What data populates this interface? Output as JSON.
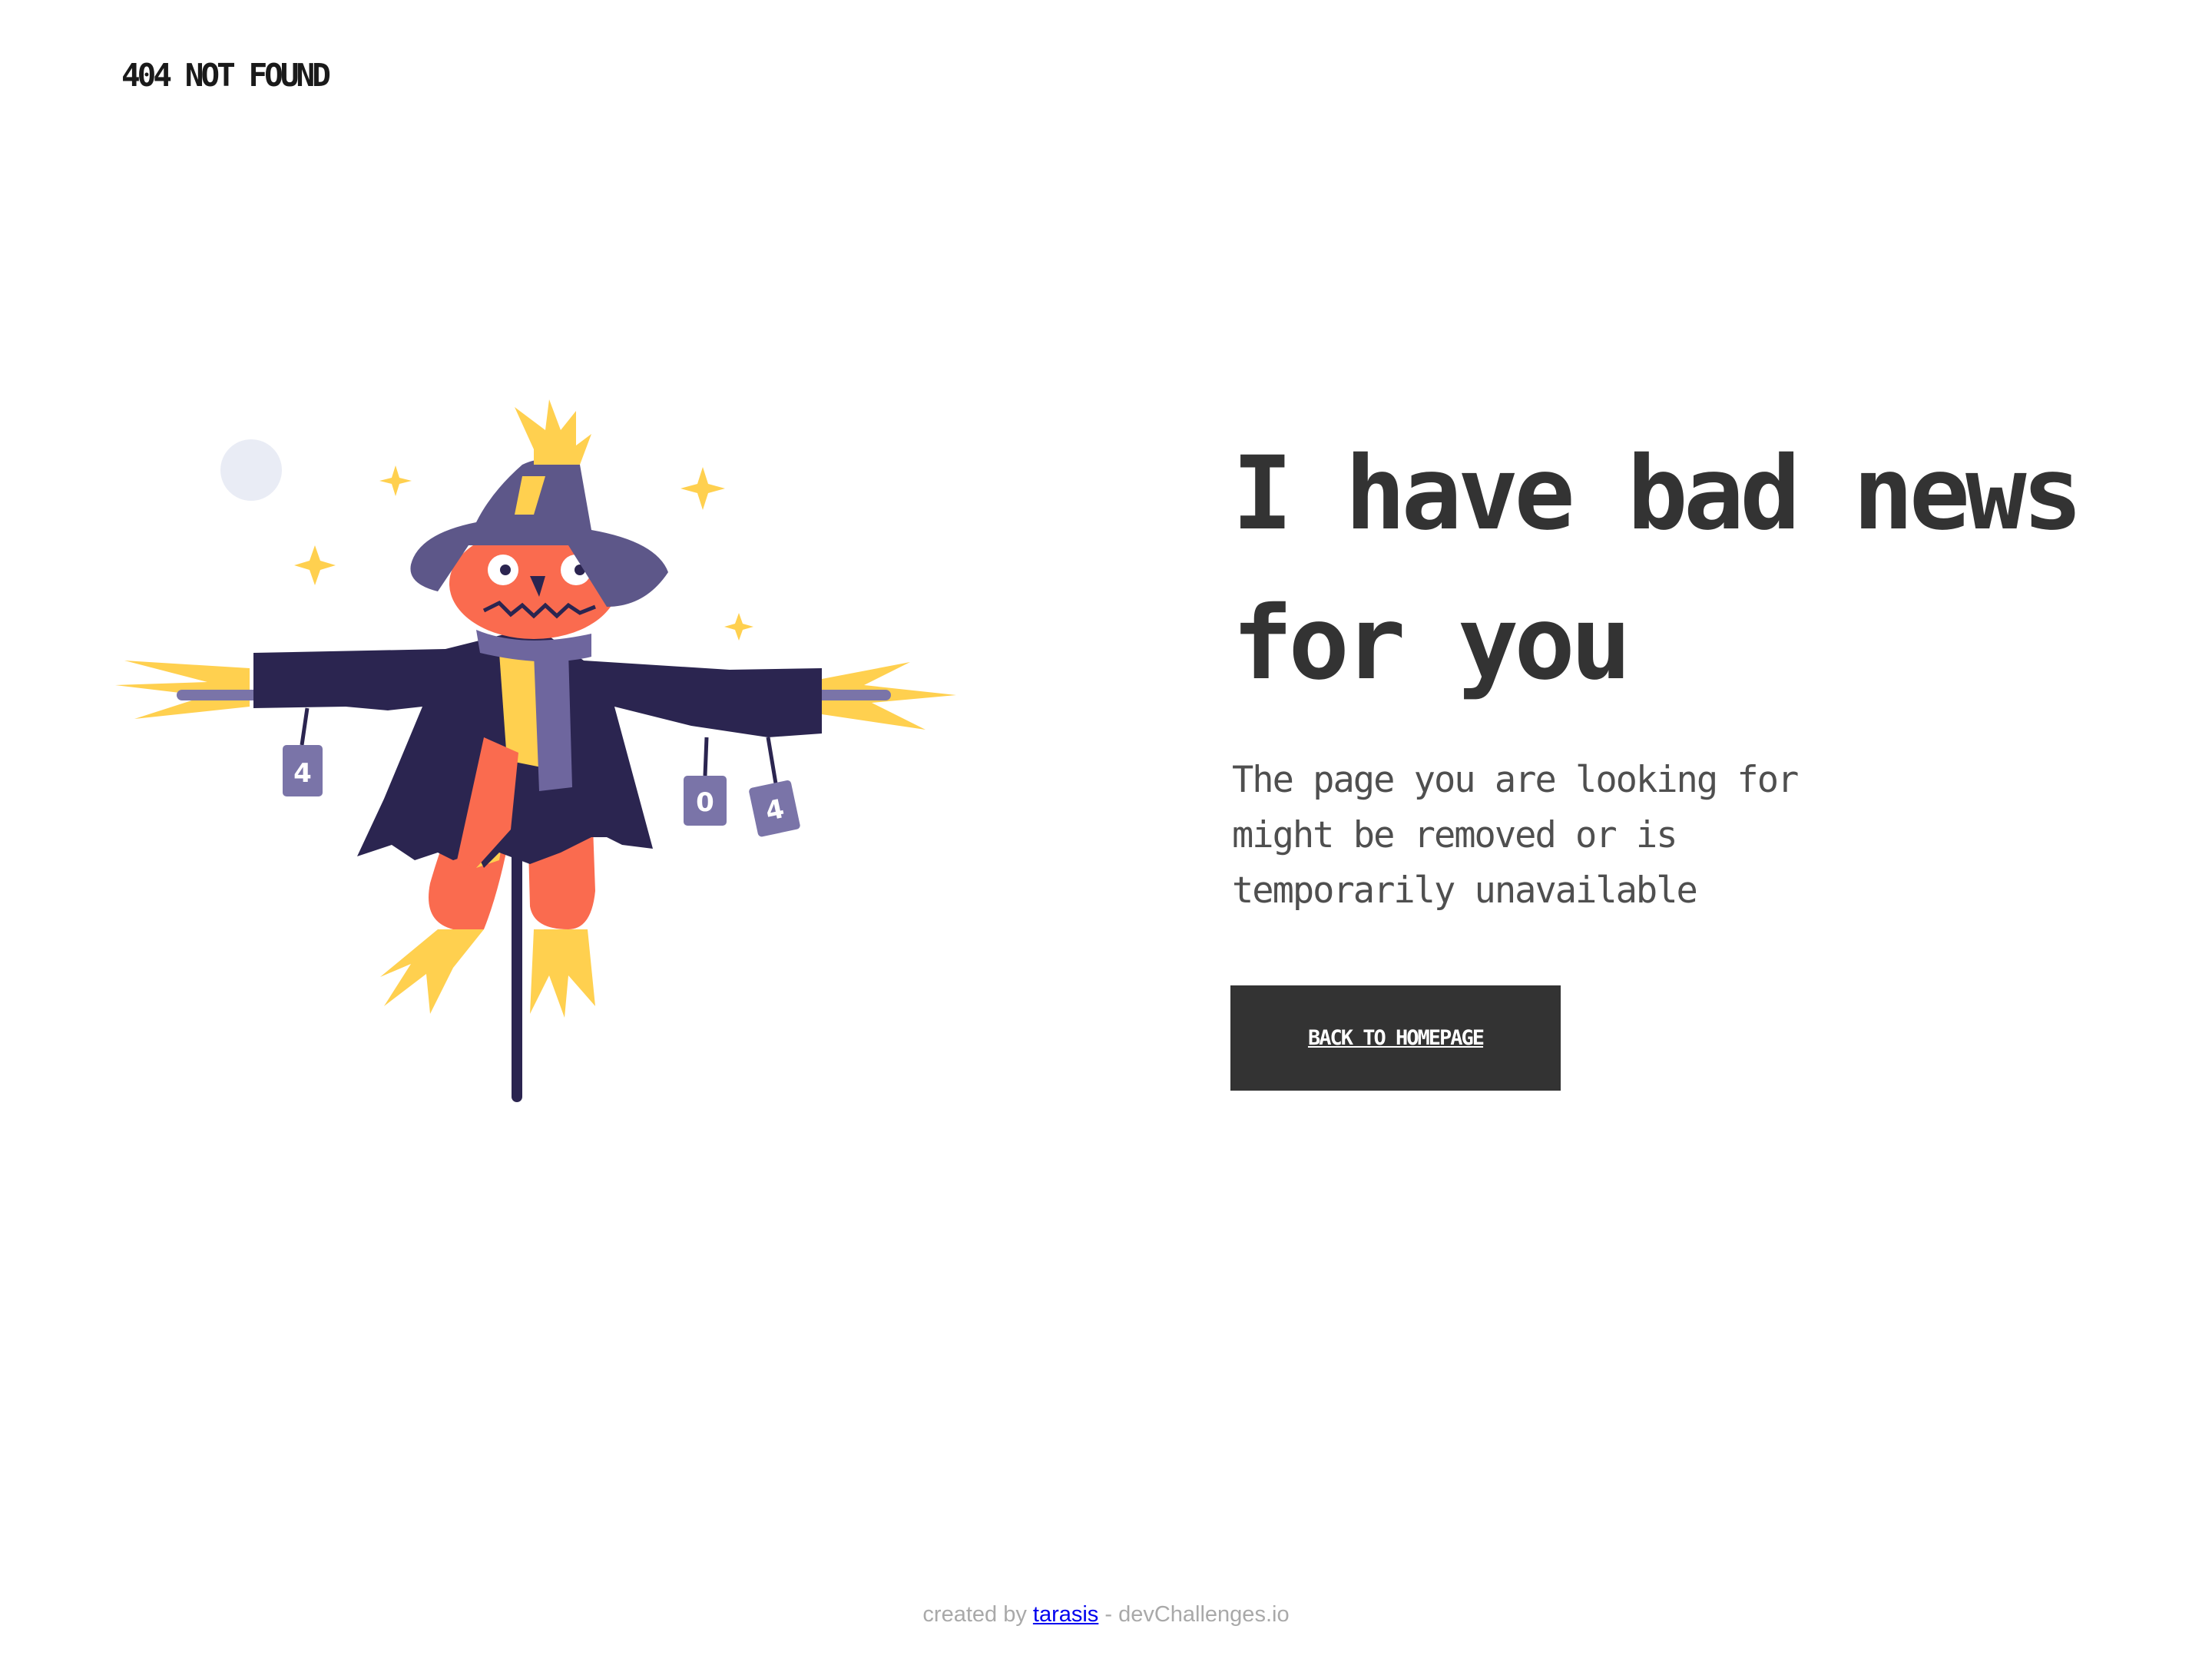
{
  "header": {
    "brand": "404 NOT FOUND"
  },
  "illustration": {
    "subject": "scarecrow-404",
    "can_labels": [
      "4",
      "0",
      "4"
    ],
    "colors": {
      "hat": "#5d5789",
      "coat": "#2b2550",
      "face": "#fa6b4f",
      "straw": "#ffd04f",
      "shirt": "#ffd04f",
      "scarf": "#6e669e",
      "moon": "#e9ecf5"
    }
  },
  "main": {
    "headline": "I have bad news for you",
    "message": "The page you are looking for might be removed or is temporarily unavailable",
    "button_label": "BACK TO HOMEPAGE"
  },
  "footer": {
    "prefix": "created by ",
    "author": "tarasis",
    "suffix": " - devChallenges.io"
  },
  "colors": {
    "text_dark": "#333333",
    "button_bg": "#333333",
    "button_text": "#ffffff",
    "footer_text": "#a9a9a9",
    "link": "#0000ee"
  }
}
